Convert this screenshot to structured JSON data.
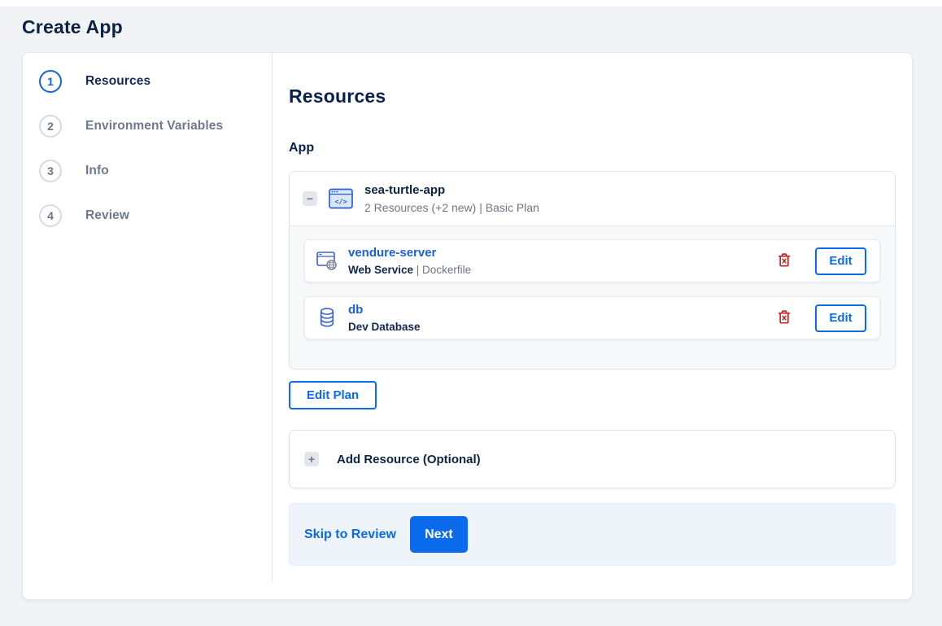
{
  "page": {
    "title": "Create App"
  },
  "colors": {
    "accent_blue": "#0b6bec",
    "navy_text": "#082050",
    "gray_text": "#6d7586",
    "danger_red": "#c41f1f",
    "page_bg": "#f1f3f7",
    "footer_bg": "#eff4fb"
  },
  "stepper": {
    "items": [
      {
        "number": "1",
        "label": "Resources",
        "active": true
      },
      {
        "number": "2",
        "label": "Environment Variables",
        "active": false
      },
      {
        "number": "3",
        "label": "Info",
        "active": false
      },
      {
        "number": "4",
        "label": "Review",
        "active": false
      }
    ]
  },
  "main": {
    "heading": "Resources",
    "section_label": "App",
    "app_group": {
      "collapse_glyph": "−",
      "name": "sea-turtle-app",
      "summary": "2 Resources (+2 new) | Basic Plan",
      "resources": [
        {
          "name": "vendure-server",
          "type_label": "Web Service",
          "source_label": " | Dockerfile",
          "icon": "web-service-icon",
          "edit_label": "Edit"
        },
        {
          "name": "db",
          "type_label": "Dev Database",
          "source_label": "",
          "icon": "database-icon",
          "edit_label": "Edit"
        }
      ]
    },
    "edit_plan_label": "Edit Plan",
    "add_resource": {
      "plus_glyph": "+",
      "label": "Add Resource (Optional)"
    },
    "footer": {
      "skip_label": "Skip to Review",
      "next_label": "Next"
    }
  }
}
